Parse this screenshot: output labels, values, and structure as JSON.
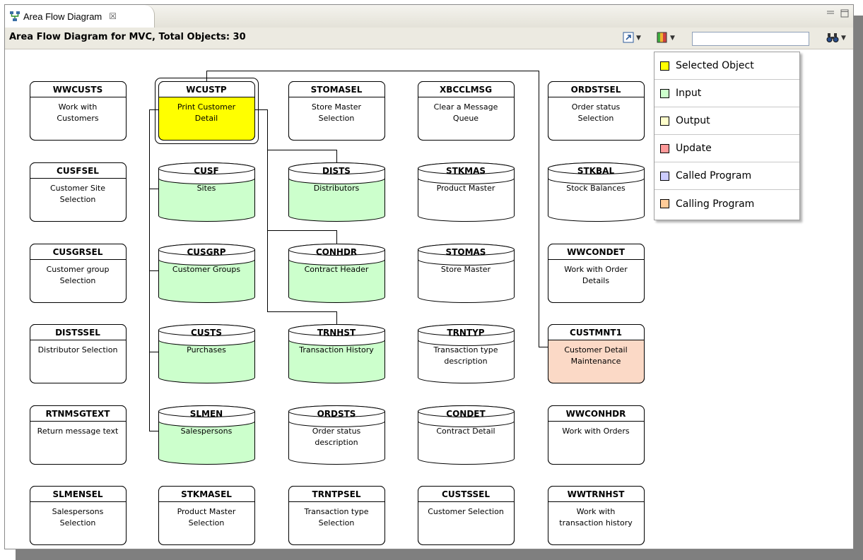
{
  "tab": {
    "label": "Area Flow Diagram",
    "close": "☒"
  },
  "header": {
    "title": "Area Flow Diagram for MVC, Total Objects: 30"
  },
  "search": {
    "value": ""
  },
  "legend": [
    {
      "label": "Selected Object",
      "color": "#ffff00"
    },
    {
      "label": "Input",
      "color": "#ccffcc"
    },
    {
      "label": "Output",
      "color": "#ffffcc"
    },
    {
      "label": "Update",
      "color": "#ff9999"
    },
    {
      "label": "Called Program",
      "color": "#ccccff"
    },
    {
      "label": "Calling Program",
      "color": "#ffcc99"
    }
  ],
  "nodes": [
    {
      "name": "WWCUSTS",
      "desc": "Work with|Customers",
      "kind": "program",
      "role": "none"
    },
    {
      "name": "WCUSTP",
      "desc": "Print Customer|Detail",
      "kind": "program",
      "role": "selected"
    },
    {
      "name": "STOMASEL",
      "desc": "Store Master|Selection",
      "kind": "program",
      "role": "none"
    },
    {
      "name": "XBCCLMSG",
      "desc": "Clear a Message|Queue",
      "kind": "program",
      "role": "none"
    },
    {
      "name": "ORDSTSEL",
      "desc": "Order status|Selection",
      "kind": "program",
      "role": "none"
    },
    {
      "name": "CUSFSEL",
      "desc": "Customer Site|Selection",
      "kind": "program",
      "role": "none"
    },
    {
      "name": "CUSF",
      "desc": "Sites",
      "kind": "file",
      "role": "input"
    },
    {
      "name": "DISTS",
      "desc": "Distributors",
      "kind": "file",
      "role": "input"
    },
    {
      "name": "STKMAS",
      "desc": "Product Master",
      "kind": "file",
      "role": "none"
    },
    {
      "name": "STKBAL",
      "desc": "Stock Balances",
      "kind": "file",
      "role": "none"
    },
    {
      "name": "CUSGRSEL",
      "desc": "Customer group|Selection",
      "kind": "program",
      "role": "none"
    },
    {
      "name": "CUSGRP",
      "desc": "Customer Groups",
      "kind": "file",
      "role": "input"
    },
    {
      "name": "CONHDR",
      "desc": "Contract Header",
      "kind": "file",
      "role": "input"
    },
    {
      "name": "STOMAS",
      "desc": "Store Master",
      "kind": "file",
      "role": "none"
    },
    {
      "name": "WWCONDET",
      "desc": "Work with Order|Details",
      "kind": "program",
      "role": "none"
    },
    {
      "name": "DISTSSEL",
      "desc": "Distributor Selection",
      "kind": "program",
      "role": "none"
    },
    {
      "name": "CUSTS",
      "desc": "Purchases",
      "kind": "file",
      "role": "input"
    },
    {
      "name": "TRNHST",
      "desc": "Transaction History",
      "kind": "file",
      "role": "input"
    },
    {
      "name": "TRNTYP",
      "desc": "Transaction type|description",
      "kind": "file",
      "role": "none"
    },
    {
      "name": "CUSTMNT1",
      "desc": "Customer Detail|Maintenance",
      "kind": "program",
      "role": "calling"
    },
    {
      "name": "RTNMSGTEXT",
      "desc": "Return message text",
      "kind": "program",
      "role": "none"
    },
    {
      "name": "SLMEN",
      "desc": "Salespersons",
      "kind": "file",
      "role": "input"
    },
    {
      "name": "ORDSTS",
      "desc": "Order status|description",
      "kind": "file",
      "role": "none"
    },
    {
      "name": "CONDET",
      "desc": "Contract Detail",
      "kind": "file",
      "role": "none"
    },
    {
      "name": "WWCONHDR",
      "desc": "Work with Orders",
      "kind": "program",
      "role": "none"
    },
    {
      "name": "SLMENSEL",
      "desc": "Salespersons|Selection",
      "kind": "program",
      "role": "none"
    },
    {
      "name": "STKMASEL",
      "desc": "Product Master|Selection",
      "kind": "program",
      "role": "none"
    },
    {
      "name": "TRNTPSEL",
      "desc": "Transaction type|Selection",
      "kind": "program",
      "role": "none"
    },
    {
      "name": "CUSTSSEL",
      "desc": "Customer Selection",
      "kind": "program",
      "role": "none"
    },
    {
      "name": "WWTRNHST",
      "desc": "Work with|transaction history",
      "kind": "program",
      "role": "none"
    }
  ]
}
